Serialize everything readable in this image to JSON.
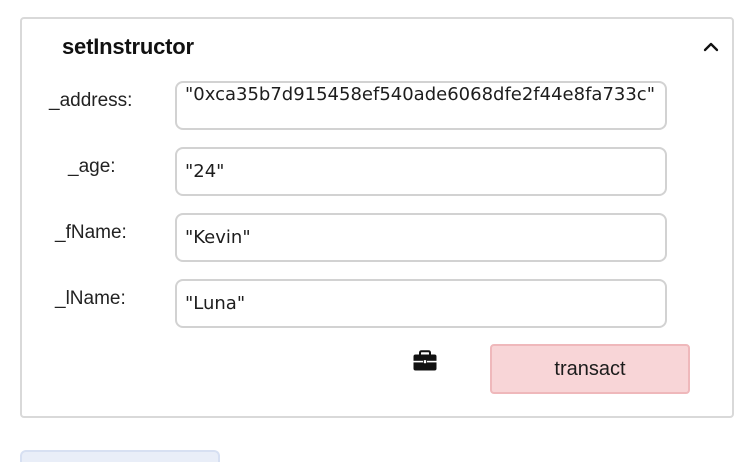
{
  "function_panel": {
    "title": "setInstructor",
    "collapse_icon": "chevron-up-icon",
    "fields": [
      {
        "label": "_address:",
        "value": "\"0xca35b7d915458ef540ade6068dfe2f44e8fa733c\""
      },
      {
        "label": "_age:",
        "value": "\"24\""
      },
      {
        "label": "_fName:",
        "value": "\"Kevin\""
      },
      {
        "label": "_lName:",
        "value": "\"Luna\""
      }
    ],
    "tool_icon": "briefcase-icon",
    "transact_label": "transact"
  },
  "colors": {
    "transact_bg": "#f8d5d7",
    "transact_border": "#efb8bb",
    "panel_border": "#d9d9d9",
    "field_border": "#d2d2d2"
  }
}
